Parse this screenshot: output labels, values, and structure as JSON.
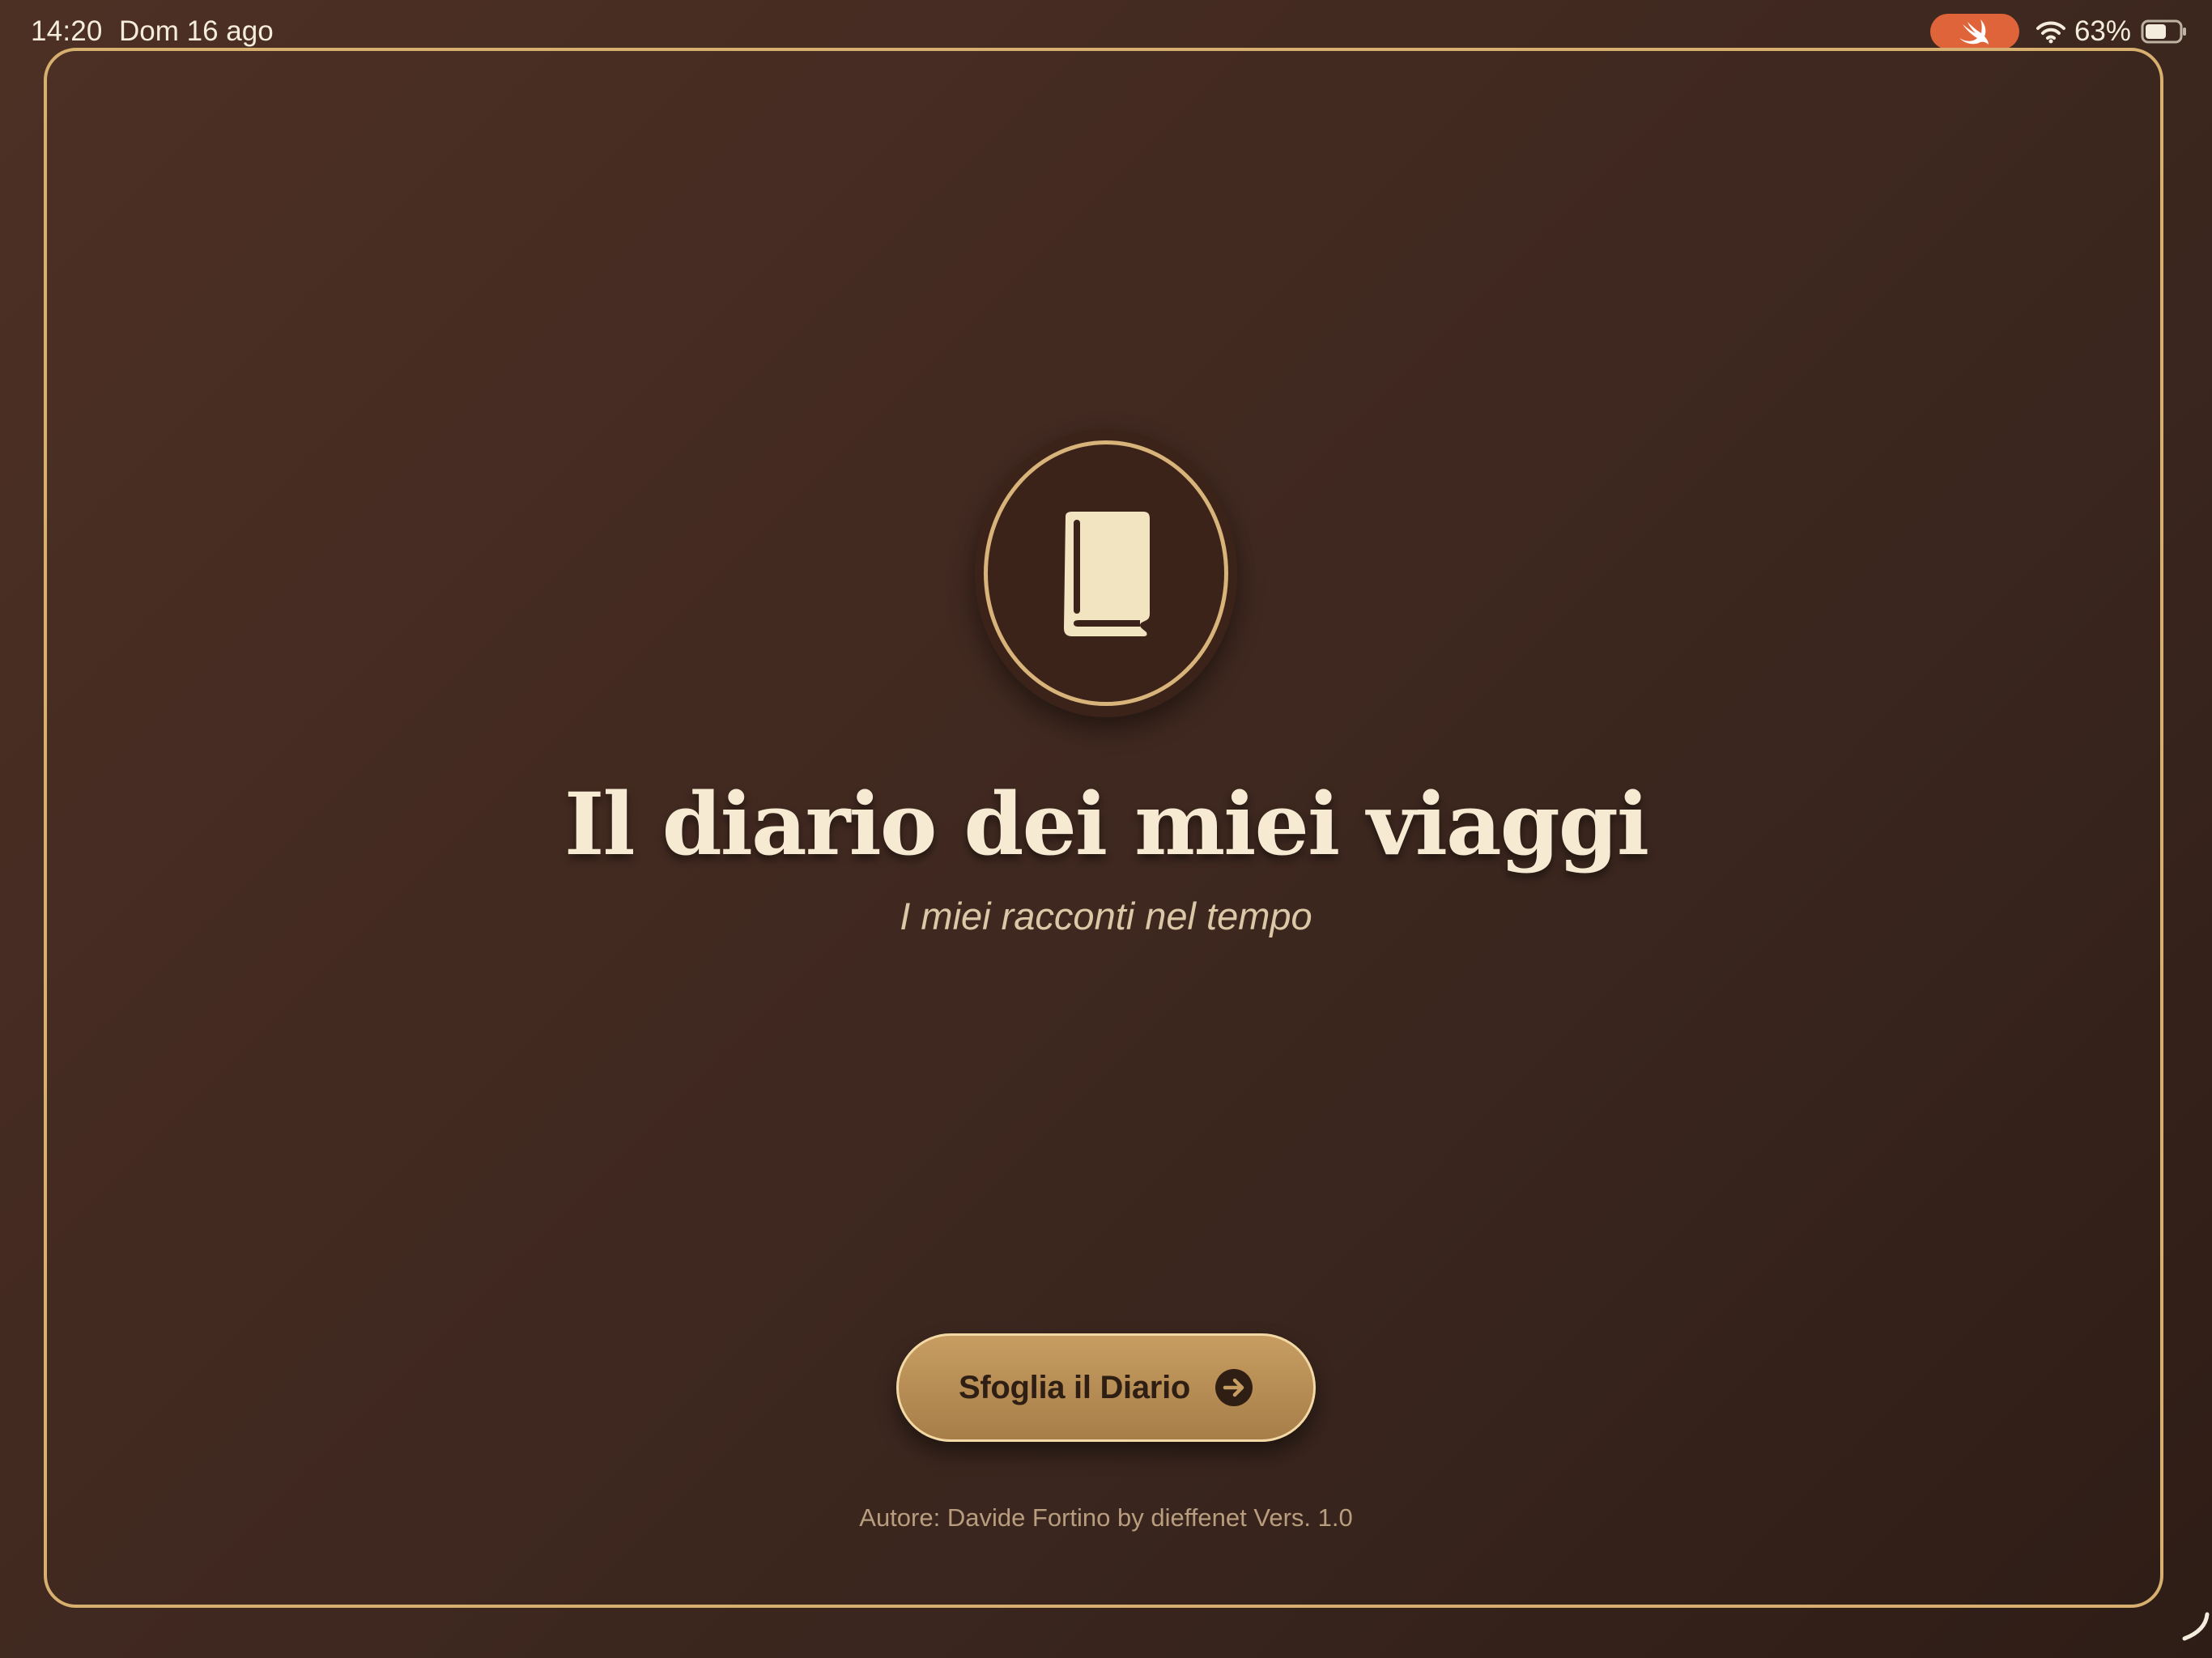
{
  "status_bar": {
    "time": "14:20",
    "date": "Dom 16 ago",
    "battery_percent": "63%",
    "battery_level": 0.63,
    "active_app_icon": "swift-icon",
    "wifi_icon": "wifi-icon",
    "battery_icon": "battery-icon"
  },
  "colors": {
    "background": "#432a21",
    "frame_gold": "#d7b06f",
    "button_gold": "#b88d55",
    "title_cream": "#f6ebd2",
    "swift_orange": "#e0643a"
  },
  "hero": {
    "icon": "book-icon",
    "title": "Il diario dei miei viaggi",
    "subtitle": "I miei racconti nel tempo"
  },
  "actions": {
    "browse_label": "Sfoglia il Diario",
    "browse_icon": "arrow-right-circle-icon"
  },
  "footer": {
    "credits": "Autore: Davide Fortino by dieffenet Vers. 1.0"
  }
}
